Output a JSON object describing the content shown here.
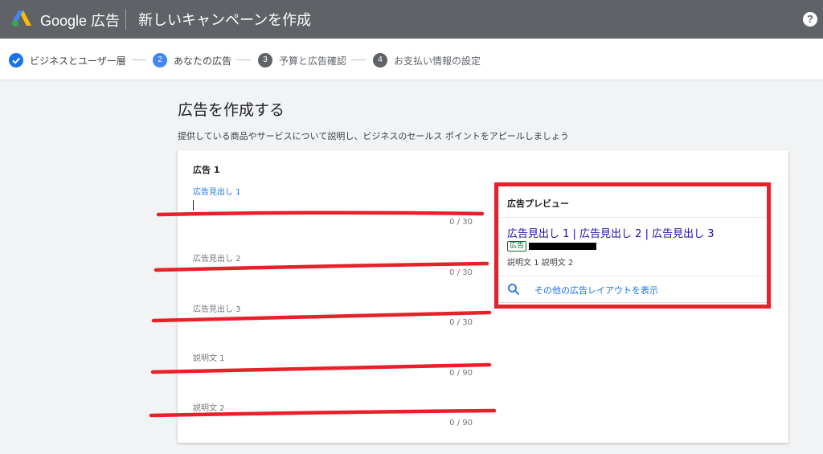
{
  "header": {
    "brand": "Google 広告",
    "page_title": "新しいキャンペーンを作成",
    "help_icon": "?"
  },
  "stepper": {
    "steps": [
      {
        "number": "",
        "label": "ビジネスとユーザー層",
        "state": "done"
      },
      {
        "number": "2",
        "label": "あなたの広告",
        "state": "active"
      },
      {
        "number": "3",
        "label": "予算と広告確認",
        "state": "todo"
      },
      {
        "number": "4",
        "label": "お支払い情報の設定",
        "state": "todo"
      }
    ]
  },
  "main": {
    "title": "広告を作成する",
    "subtitle": "提供している商品やサービスについて説明し、ビジネスのセールス ポイントをアピールしましょう"
  },
  "card": {
    "title": "広告 1",
    "fields": [
      {
        "label": "広告見出し 1",
        "counter": "0 / 30",
        "focused": true
      },
      {
        "label": "広告見出し 2",
        "counter": "0 / 30",
        "focused": false
      },
      {
        "label": "広告見出し 3",
        "counter": "0 / 30",
        "focused": false
      },
      {
        "label": "説明文 1",
        "counter": "0 / 90",
        "focused": false
      },
      {
        "label": "説明文 2",
        "counter": "0 / 90",
        "focused": false
      }
    ]
  },
  "preview": {
    "title": "広告プレビュー",
    "headline": "広告見出し 1 | 広告見出し 2 | 広告見出し 3",
    "ad_badge": "広告",
    "description": "説明文 1 説明文 2",
    "more_layouts": "その他の広告レイアウトを表示"
  },
  "colors": {
    "topbar": "#5f6368",
    "accent": "#1a73e8",
    "annotation_red": "#e8202a"
  }
}
